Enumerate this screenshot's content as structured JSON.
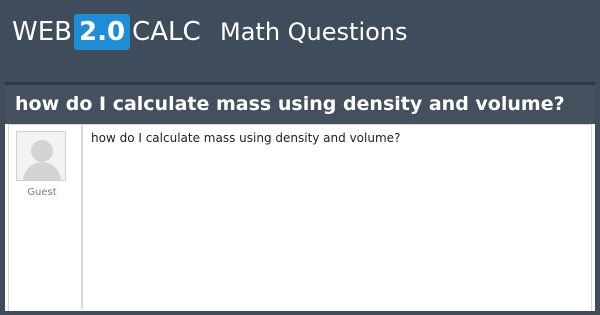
{
  "header": {
    "logo": {
      "prefix": "WEB",
      "badge": "2.0",
      "suffix": "CALC"
    },
    "site_title": "Math Questions"
  },
  "question": {
    "title": "how do I calculate mass using density and volume?",
    "body": "how do I calculate mass using density and volume?",
    "author": "Guest"
  },
  "colors": {
    "background": "#3f4c5c",
    "badge": "#1f8dd6",
    "question_bar": "#45505e"
  }
}
